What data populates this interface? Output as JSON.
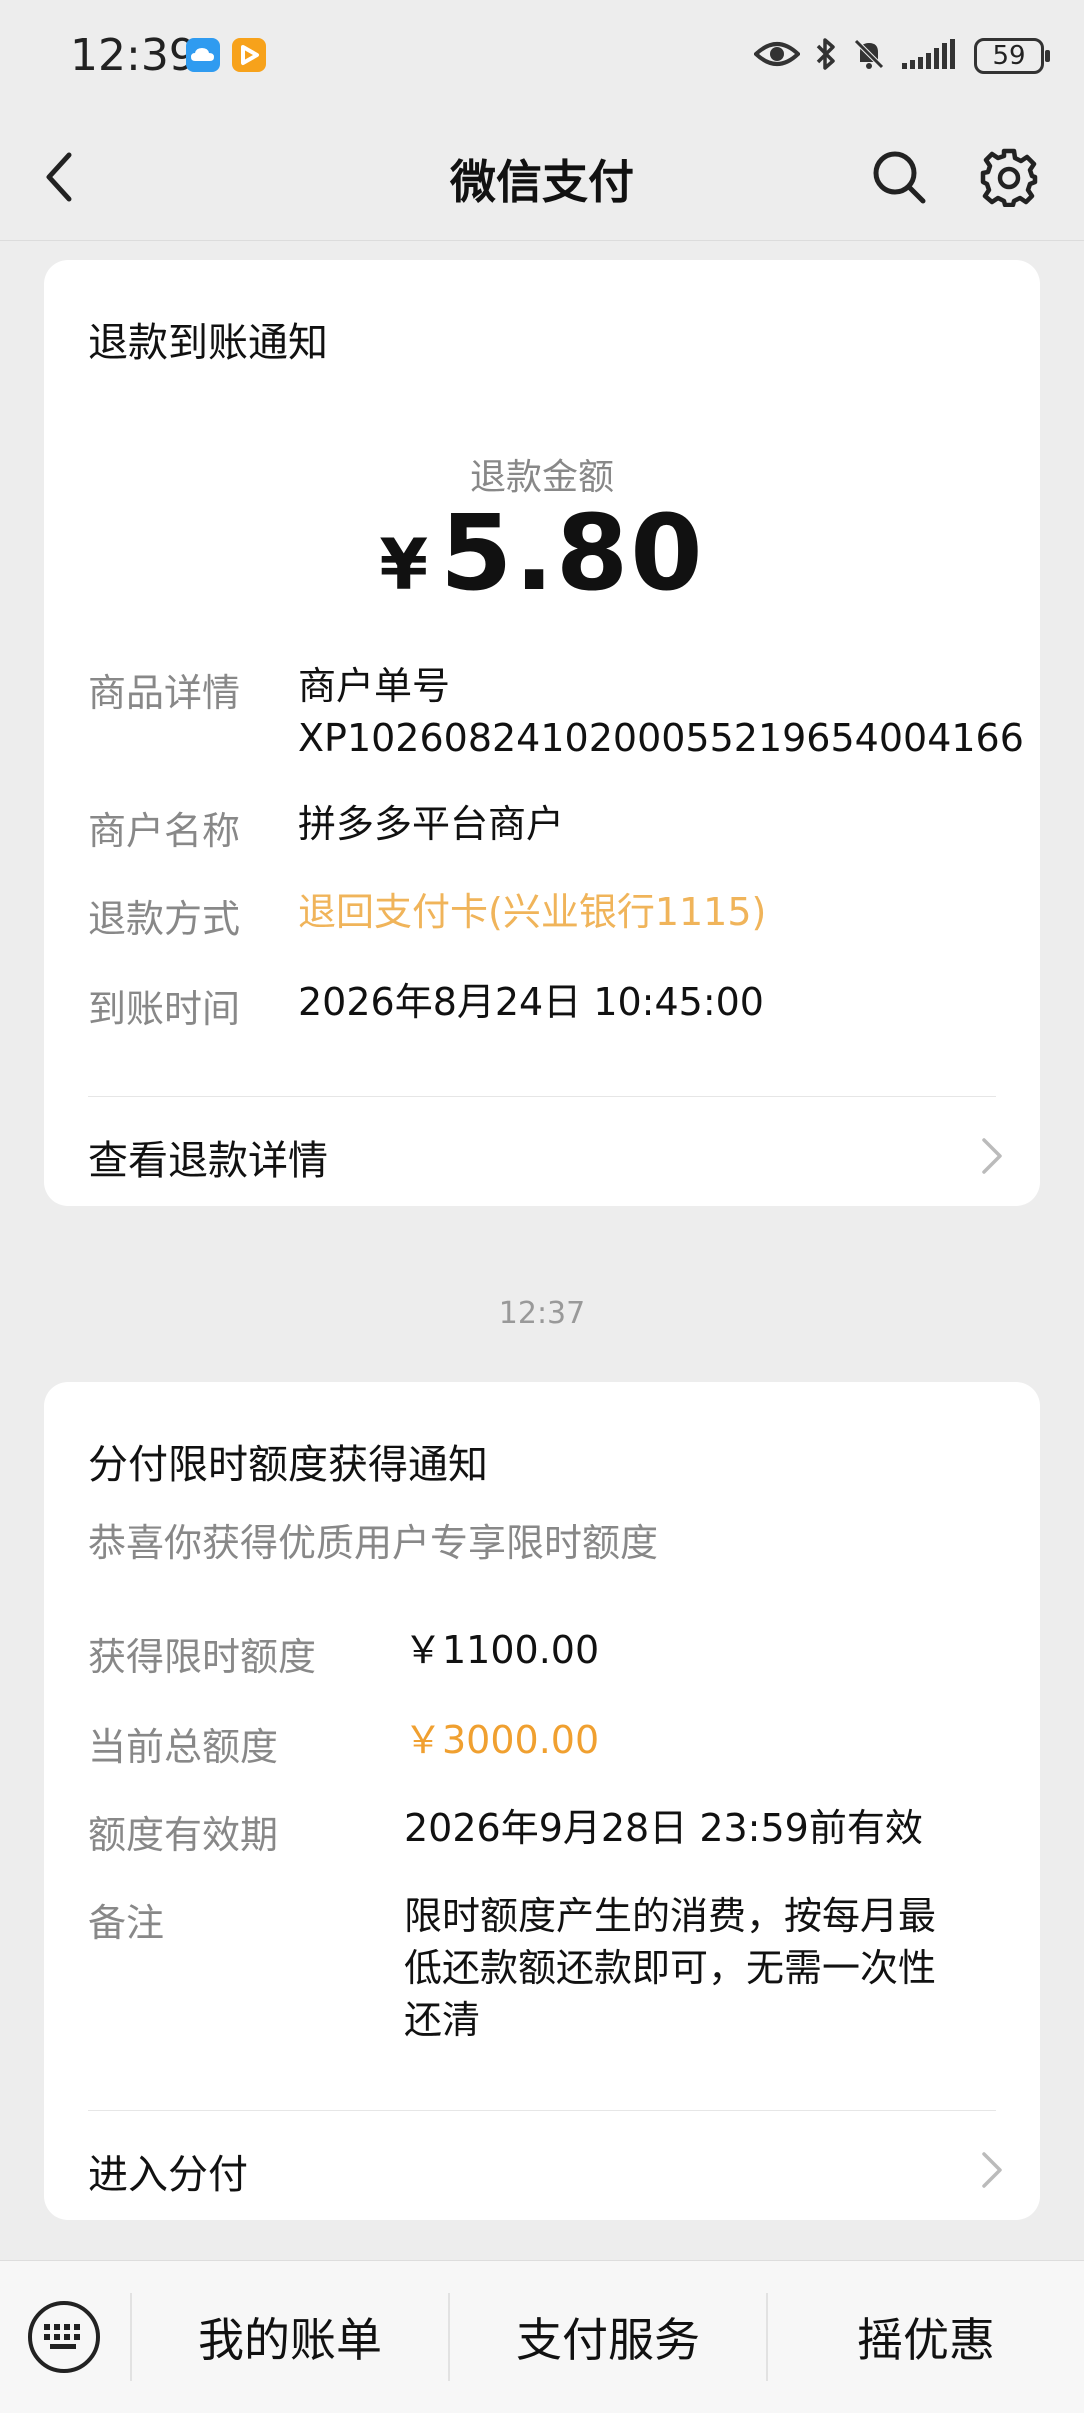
{
  "status_bar": {
    "time": "12:39",
    "battery": "59"
  },
  "nav": {
    "title": "微信支付"
  },
  "refund_card": {
    "title": "退款到账通知",
    "amount_label": "退款金额",
    "currency": "¥",
    "amount": "5.80",
    "rows": [
      {
        "label": "商品详情",
        "value_line1": "商户单号",
        "value_line2": "XP1026082410200055219654004166"
      },
      {
        "label": "商户名称",
        "value": "拼多多平台商户"
      },
      {
        "label": "退款方式",
        "value": "退回支付卡(兴业银行1115)"
      },
      {
        "label": "到账时间",
        "value": "2026年8月24日 10:45:00"
      }
    ],
    "link": "查看退款详情"
  },
  "timestamp": "12:37",
  "credit_card": {
    "title": "分付限时额度获得通知",
    "subtitle": "恭喜你获得优质用户专享限时额度",
    "rows": [
      {
        "label": "获得限时额度",
        "value": "￥1100.00"
      },
      {
        "label": "当前总额度",
        "value": "￥3000.00"
      },
      {
        "label": "额度有效期",
        "value": "2026年9月28日 23:59前有效"
      },
      {
        "label": "备注",
        "value_lines": [
          "限时额度产生的消费，按每月最",
          "低还款额还款即可，无需一次性",
          "还清"
        ]
      }
    ],
    "link": "进入分付"
  },
  "bottom_menu": {
    "items": [
      "我的账单",
      "支付服务",
      "摇优惠"
    ]
  },
  "colors": {
    "accent_orange": "#f0b45a",
    "accent_orange_strong": "#f0a030"
  }
}
